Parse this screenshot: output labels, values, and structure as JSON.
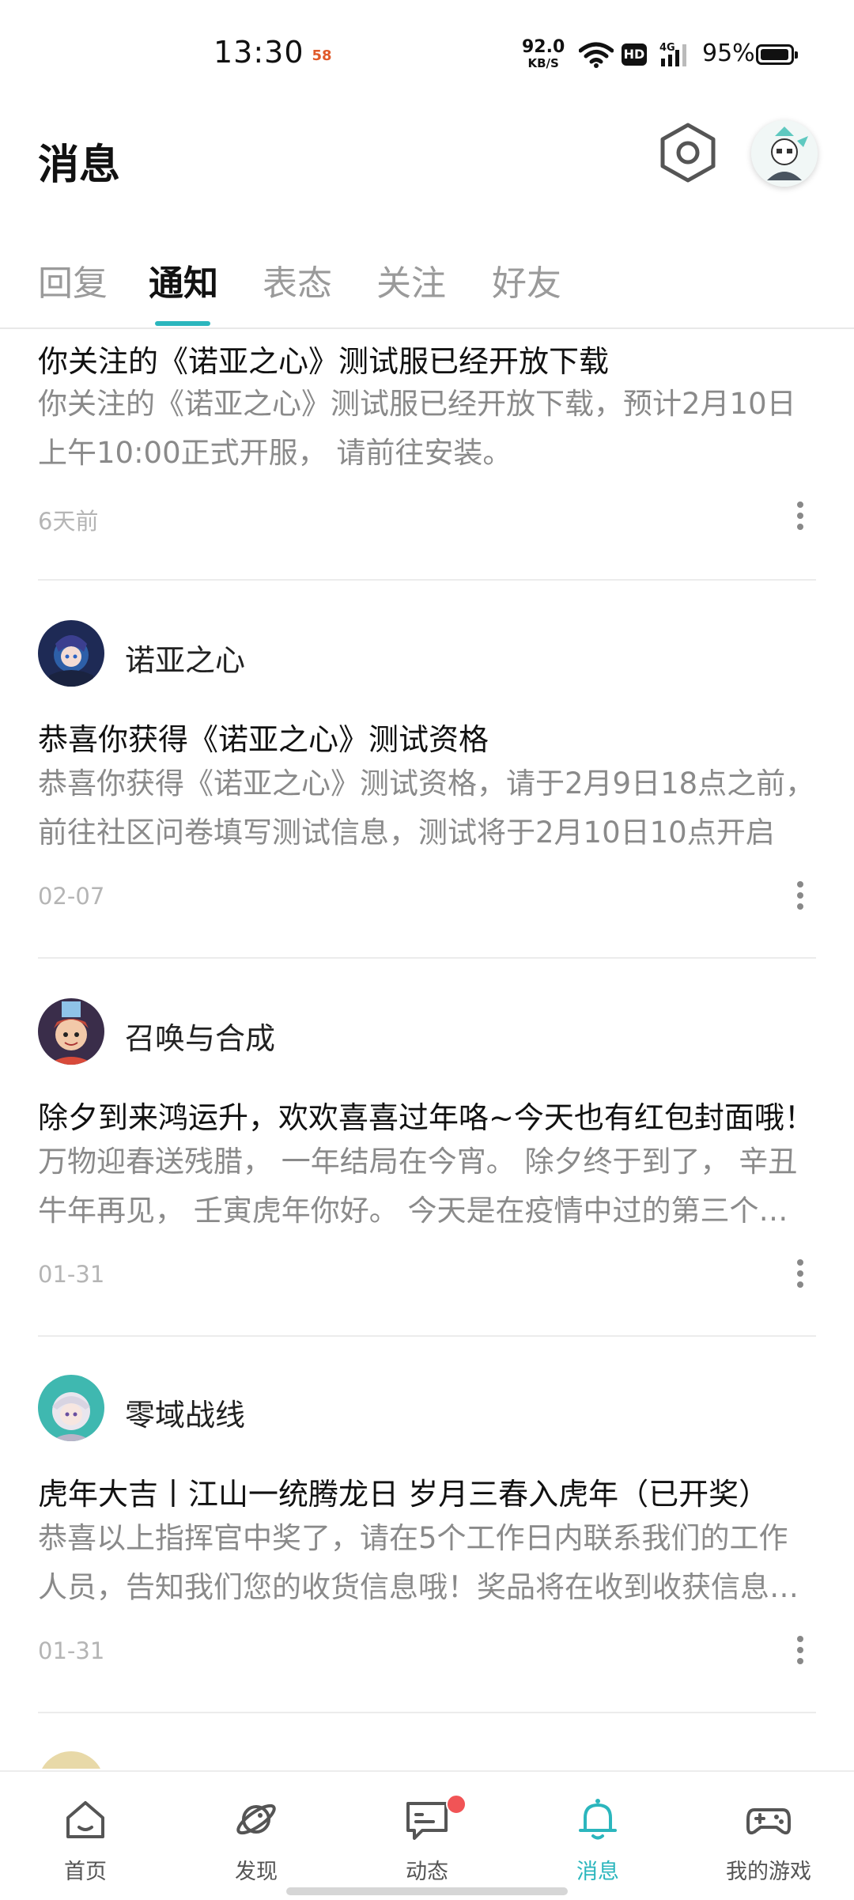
{
  "status_bar": {
    "time": "13:30",
    "app_icon_text": "58",
    "net_speed": "92.0",
    "net_unit": "KB/S",
    "hd": "HD",
    "network": "4G",
    "battery": "95%"
  },
  "header": {
    "title": "消息",
    "settings_icon": "hexagon-settings-icon",
    "avatar_icon": "user-avatar"
  },
  "tabs": [
    {
      "label": "回复",
      "active": false
    },
    {
      "label": "通知",
      "active": true
    },
    {
      "label": "表态",
      "active": false
    },
    {
      "label": "关注",
      "active": false
    },
    {
      "label": "好友",
      "active": false
    }
  ],
  "accent_color": "#2bb6bd",
  "notifications": [
    {
      "title": "你关注的《诺亚之心》测试服已经开放下载",
      "body": "你关注的《诺亚之心》测试服已经开放下载，预计2月10日上午10:00正式开服， 请前往安装。",
      "time": "6天前"
    },
    {
      "sender": "诺亚之心",
      "title": "恭喜你获得《诺亚之心》测试资格",
      "body": "恭喜你获得《诺亚之心》测试资格，请于2月9日18点之前，前往社区问卷填写测试信息，测试将于2月10日10点开启",
      "time": "02-07"
    },
    {
      "sender": "召唤与合成",
      "title": "除夕到来鸿运升，欢欢喜喜过年咯~今天也有红包封面哦！",
      "body": "万物迎春送残腊， 一年结局在今宵。 除夕终于到了， 辛丑牛年再见， 壬寅虎年你好。 今天是在疫情中过的第三个春节",
      "time": "01-31"
    },
    {
      "sender": "零域战线",
      "title": "虎年大吉丨江山一统腾龙日 岁月三春入虎年（已开奖）",
      "body": "恭喜以上指挥官中奖了，请在5个工作日内联系我们的工作人员，告知我们您的收货信息哦！奖品将在收到收获信息后发出",
      "time": "01-31"
    }
  ],
  "bottom_nav": [
    {
      "label": "首页",
      "icon": "home-icon",
      "active": false
    },
    {
      "label": "发现",
      "icon": "discover-planet-icon",
      "active": false
    },
    {
      "label": "动态",
      "icon": "feed-chat-icon",
      "active": false,
      "badge": true
    },
    {
      "label": "消息",
      "icon": "bell-icon",
      "active": true
    },
    {
      "label": "我的游戏",
      "icon": "gamepad-icon",
      "active": false
    }
  ]
}
